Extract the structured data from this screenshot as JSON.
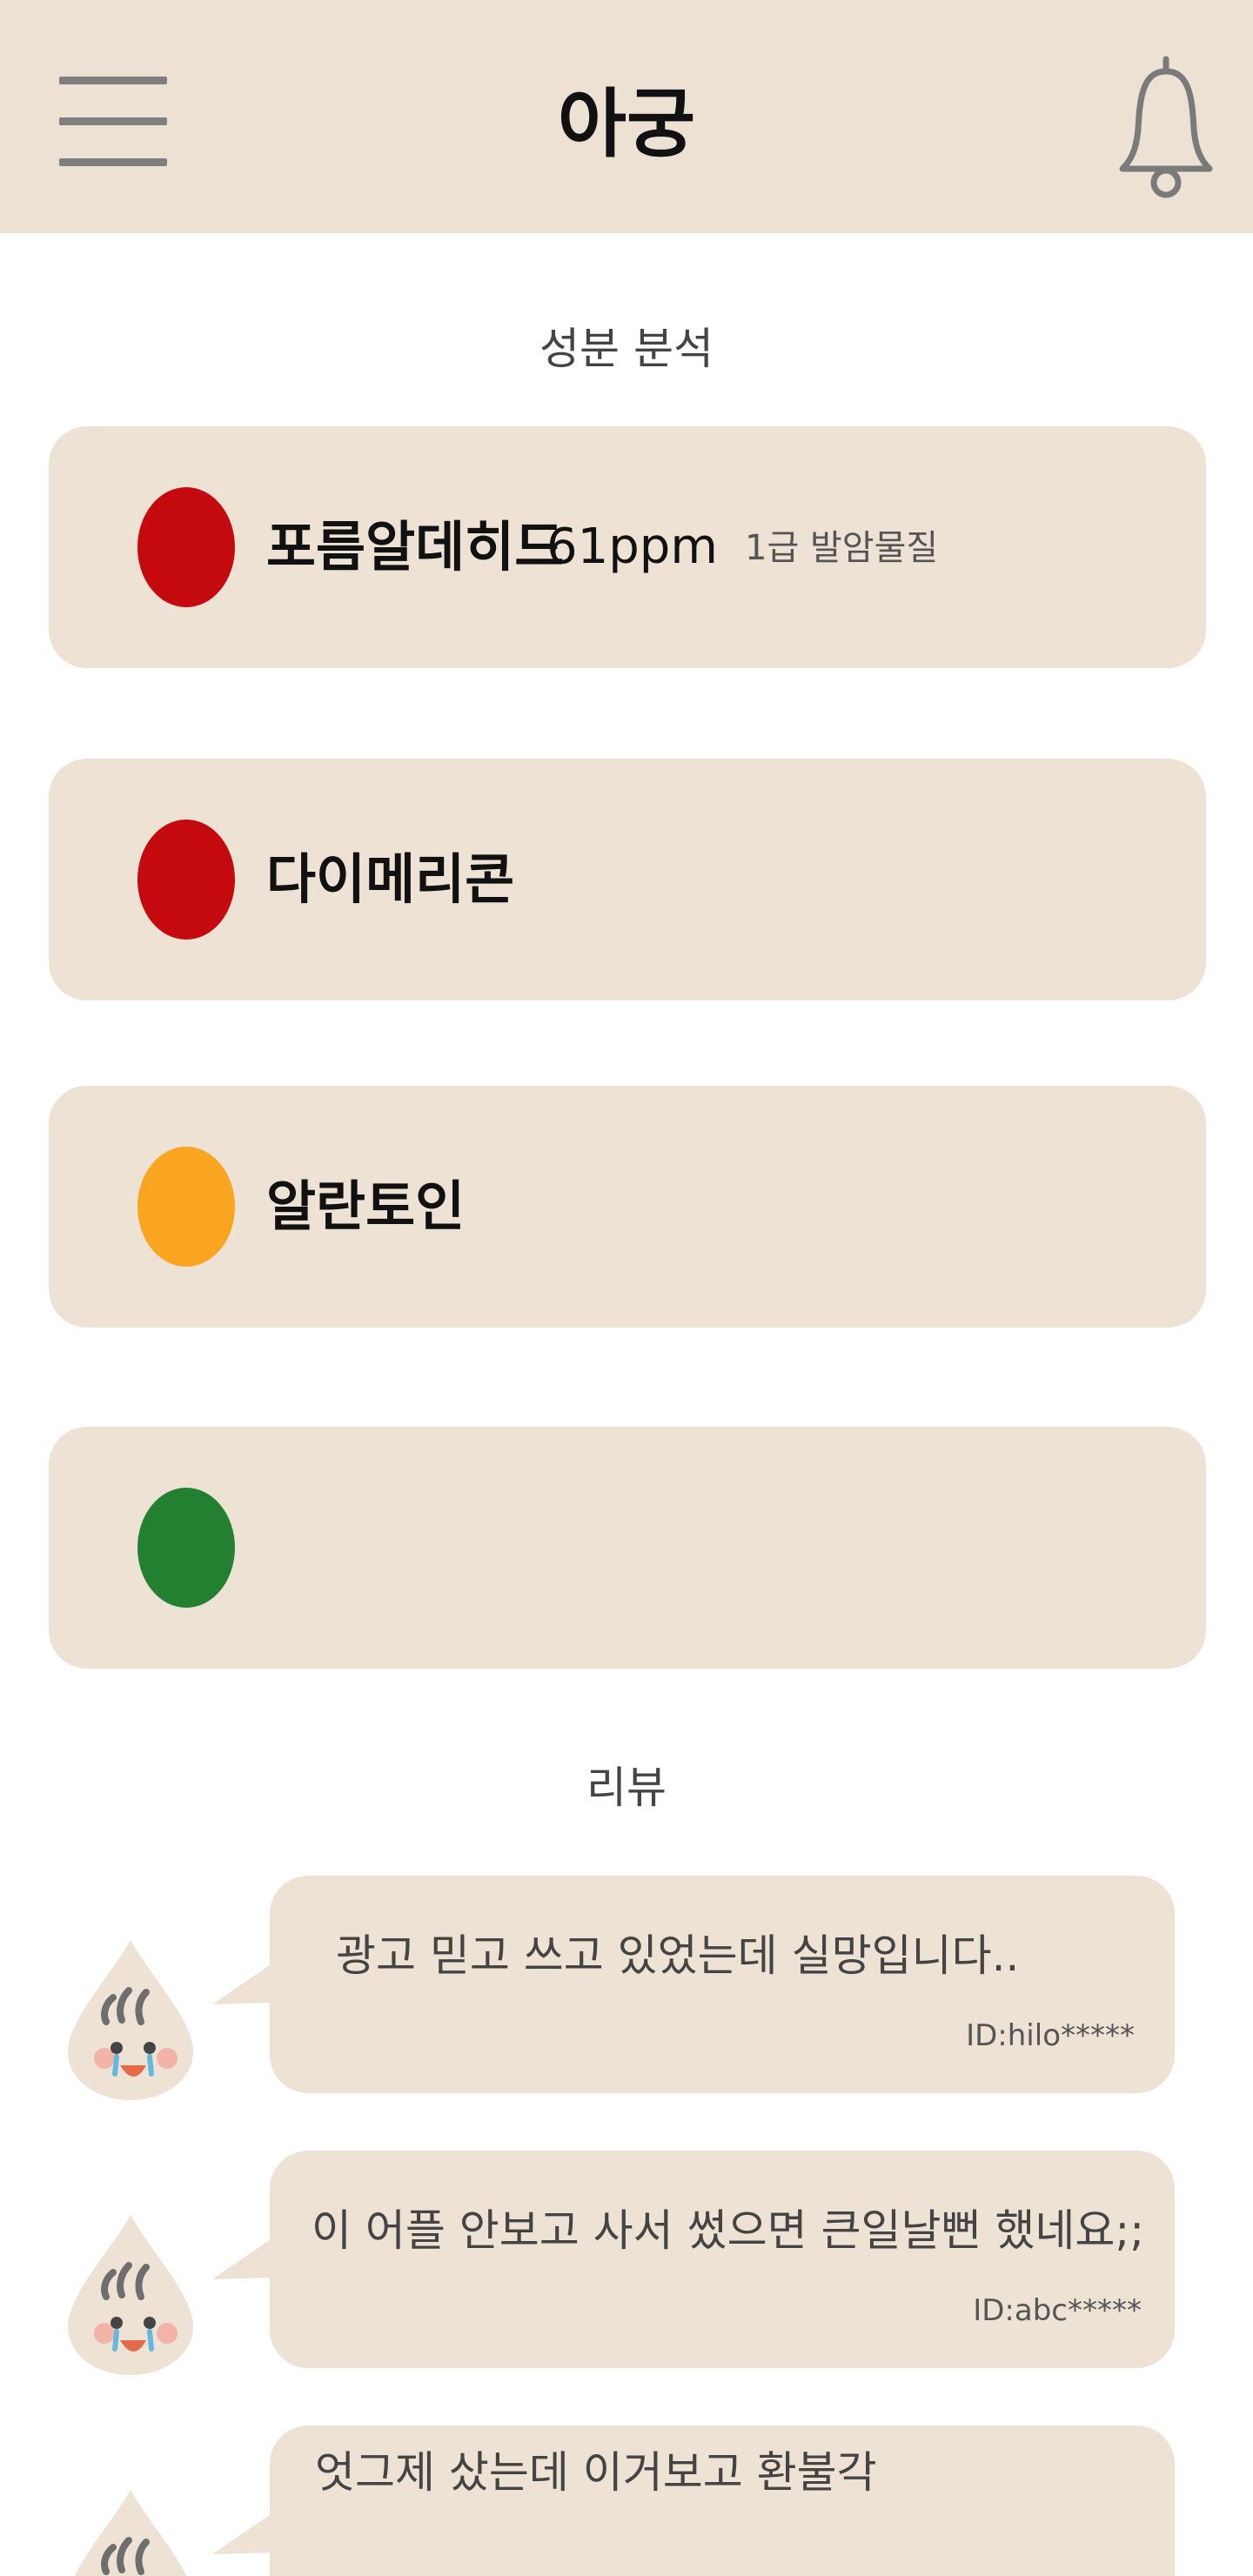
{
  "header": {
    "title": "아궁",
    "menu_icon": "hamburger-menu-icon",
    "notification_icon": "bell-icon",
    "background": "#ece1d3"
  },
  "analysis": {
    "section_title": "성분 분석",
    "ingredients": [
      {
        "name": "포름알데히드",
        "amount": "61ppm",
        "note": "1급 발암물질",
        "level_color": "#c4090f"
      },
      {
        "name": "다이메리콘",
        "amount": "",
        "note": "",
        "level_color": "#c4090f"
      },
      {
        "name": "알란토인",
        "amount": "",
        "note": "",
        "level_color": "#f9a51f"
      },
      {
        "name": "",
        "amount": "",
        "note": "",
        "level_color": "#228030"
      }
    ]
  },
  "reviews": {
    "section_title": "리뷰",
    "items": [
      {
        "text": "광고 믿고 쓰고 있었는데 실망입니다..",
        "user_id": "ID:hilo*****",
        "avatar_icon": "crying-drop-avatar-icon"
      },
      {
        "text": "이 어플 안보고 사서 썼으면 큰일날뻔 했네요;;",
        "user_id": "ID:abc*****",
        "avatar_icon": "crying-drop-avatar-icon"
      },
      {
        "text": "엇그제 샀는데 이거보고 환불각",
        "user_id": "",
        "avatar_icon": "crying-drop-avatar-icon"
      }
    ]
  }
}
